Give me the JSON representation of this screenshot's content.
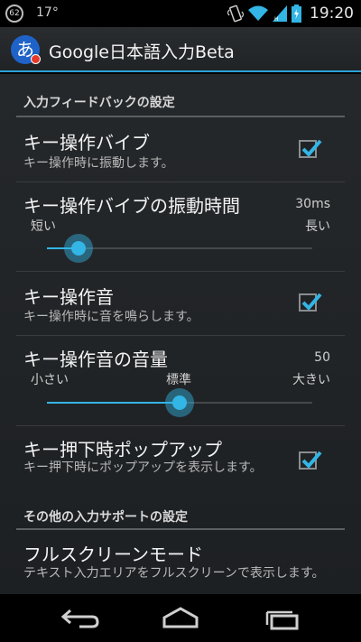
{
  "status_bar": {
    "badge": "62",
    "temperature": "17°",
    "time": "19:20",
    "icons": [
      "notification-count-icon",
      "vibrate-icon",
      "wifi-icon",
      "signal-icon",
      "battery-charging-icon"
    ]
  },
  "action_bar": {
    "app_icon_glyph": "あ",
    "title": "Google日本語入力Beta"
  },
  "sections": {
    "input_feedback": "入力フィードバックの設定",
    "other_support": "その他の入力サポートの設定"
  },
  "prefs": {
    "key_vibrate": {
      "title": "キー操作バイブ",
      "summary": "キー操作時に振動します。",
      "checked": true
    },
    "vibrate_duration": {
      "title": "キー操作バイブの振動時間",
      "value": "30ms",
      "min_label": "短い",
      "max_label": "長い",
      "level_fraction": 0.12
    },
    "key_sound": {
      "title": "キー操作音",
      "summary": "キー操作時に音を鳴らします。",
      "checked": true
    },
    "sound_volume": {
      "title": "キー操作音の音量",
      "value": "50",
      "min_label": "小さい",
      "mid_label": "標準",
      "max_label": "大きい",
      "level_fraction": 0.5
    },
    "key_popup": {
      "title": "キー押下時ポップアップ",
      "summary": "キー押下時にポップアップを表示します。",
      "checked": true
    },
    "fullscreen": {
      "title": "フルスクリーンモード",
      "summary": "テキスト入力エリアをフルスクリーンで表示します。"
    }
  },
  "colors": {
    "accent": "#33b5e5",
    "app_icon_blue": "#1f63c8",
    "app_icon_red": "#e53a2a"
  },
  "nav": {
    "back": "back-icon",
    "home": "home-icon",
    "recents": "recent-apps-icon"
  }
}
